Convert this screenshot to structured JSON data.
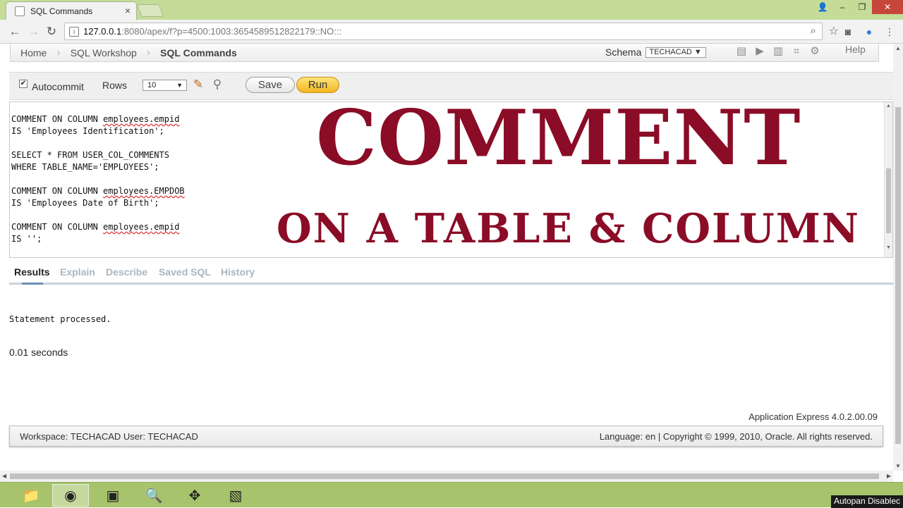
{
  "browser": {
    "tab_title": "SQL Commands",
    "tab_close": "×",
    "url_host": "127.0.0.1",
    "url_path": ":8080/apex/f?p=4500:1003:3654589512822179::NO:::",
    "window_controls": {
      "user": "👤",
      "minimize": "–",
      "maximize": "❐",
      "close": "✕"
    }
  },
  "breadcrumb": {
    "items": [
      "Home",
      "SQL Workshop",
      "SQL Commands"
    ]
  },
  "schema": {
    "label": "Schema",
    "value": "TECHACAD"
  },
  "help_label": "Help",
  "toolbar": {
    "autocommit_label": "Autocommit",
    "autocommit_checked": true,
    "rows_label": "Rows",
    "rows_value": "10",
    "save_label": "Save",
    "run_label": "Run"
  },
  "editor": {
    "lines": [
      [
        "COMMENT ON COLUMN ",
        "employees.empid",
        ""
      ],
      [
        "IS 'Employees Identification';",
        "",
        ""
      ],
      [
        "",
        "",
        ""
      ],
      [
        "SELECT * FROM USER_COL_COMMENTS",
        "",
        ""
      ],
      [
        "WHERE TABLE_NAME='EMPLOYEES';",
        "",
        ""
      ],
      [
        "",
        "",
        ""
      ],
      [
        "COMMENT ON COLUMN ",
        "employees.EMPDOB",
        ""
      ],
      [
        "IS 'Employees Date of Birth';",
        "",
        ""
      ],
      [
        "",
        "",
        ""
      ],
      [
        "COMMENT ON COLUMN ",
        "employees.empid",
        ""
      ],
      [
        "IS '';",
        "",
        ""
      ]
    ]
  },
  "overlay": {
    "title": "COMMENT",
    "subtitle": "ON A TABLE & COLUMN",
    "color": "#8a0c26"
  },
  "result_tabs": [
    "Results",
    "Explain",
    "Describe",
    "Saved SQL",
    "History"
  ],
  "results": {
    "message": "Statement processed.",
    "elapsed": "0.01 seconds"
  },
  "app_version": "Application Express 4.0.2.00.09",
  "footer": {
    "left": "Workspace: TECHACAD User: TECHACAD",
    "right": "Language: en | Copyright © 1999, 2010, Oracle. All rights reserved."
  },
  "taskbar": {
    "apps": [
      "folder-icon",
      "chrome-icon",
      "window-icon",
      "search-tool-icon",
      "paint-icon",
      "notepad-icon"
    ],
    "notice": "Autopan Disablec"
  }
}
